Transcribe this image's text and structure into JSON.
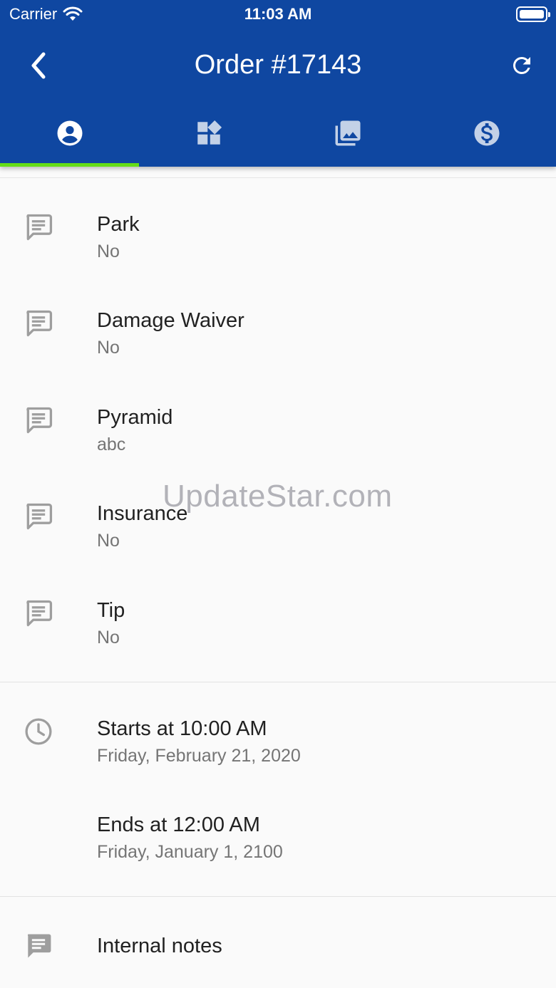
{
  "status_bar": {
    "carrier": "Carrier",
    "time": "11:03 AM"
  },
  "toolbar": {
    "title": "Order #17143",
    "back_icon": "chevron-left-icon",
    "refresh_icon": "refresh-icon"
  },
  "tabs": [
    {
      "icon": "account-circle-icon",
      "active": true
    },
    {
      "icon": "widgets-icon",
      "active": false
    },
    {
      "icon": "photo-library-icon",
      "active": false
    },
    {
      "icon": "dollar-circle-icon",
      "active": false
    }
  ],
  "custom_fields": [
    {
      "label": "Park",
      "value": "No"
    },
    {
      "label": "Damage Waiver",
      "value": "No"
    },
    {
      "label": "Pyramid",
      "value": "abc"
    },
    {
      "label": "Insurance",
      "value": "No"
    },
    {
      "label": "Tip",
      "value": "No"
    }
  ],
  "schedule": {
    "start_label": "Starts at 10:00 AM",
    "start_date": "Friday, February 21, 2020",
    "end_label": "Ends at 12:00 AM",
    "end_date": "Friday, January 1, 2100"
  },
  "notes": {
    "label": "Internal notes"
  },
  "watermark": "UpdateStar.com",
  "colors": {
    "app_bar": "#0f47a1",
    "tab_indicator": "#64dd17",
    "icon_gray": "#9e9e9e"
  }
}
